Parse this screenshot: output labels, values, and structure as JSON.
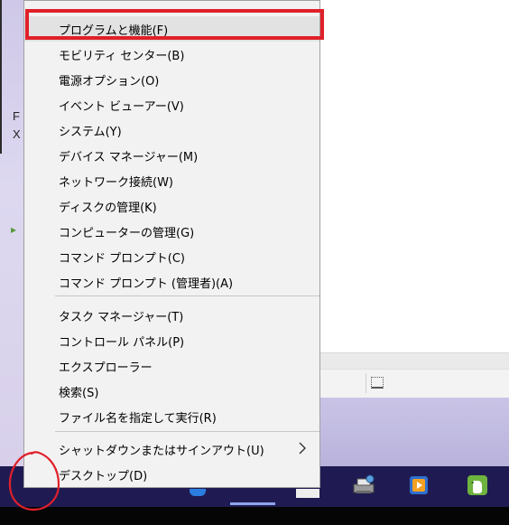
{
  "menu": {
    "items": [
      {
        "label": "プログラムと機能(F)",
        "highlighted": true
      },
      {
        "label": "モビリティ センター(B)"
      },
      {
        "label": "電源オプション(O)"
      },
      {
        "label": "イベント ビューアー(V)"
      },
      {
        "label": "システム(Y)"
      },
      {
        "label": "デバイス マネージャー(M)"
      },
      {
        "label": "ネットワーク接続(W)"
      },
      {
        "label": "ディスクの管理(K)"
      },
      {
        "label": "コンピューターの管理(G)"
      },
      {
        "label": "コマンド プロンプト(C)"
      },
      {
        "label": "コマンド プロンプト (管理者)(A)"
      },
      {
        "label": "タスク マネージャー(T)"
      },
      {
        "label": "コントロール パネル(P)"
      },
      {
        "label": "エクスプローラー"
      },
      {
        "label": "検索(S)"
      },
      {
        "label": "ファイル名を指定して実行(R)"
      },
      {
        "label": "シャットダウンまたはサインアウト(U)",
        "has_submenu": true
      },
      {
        "label": "デスクトップ(D)"
      }
    ]
  },
  "background": {
    "left_letters": [
      "F",
      "X"
    ]
  },
  "taskbar": {
    "icons": [
      "network-printer-icon",
      "media-player-icon",
      "evernote-icon"
    ]
  },
  "colors": {
    "annotation_red": "#e0202a",
    "menu_background": "#f2f2f2",
    "highlight": "#e2e2e2",
    "taskbar": "#1f1b52"
  }
}
